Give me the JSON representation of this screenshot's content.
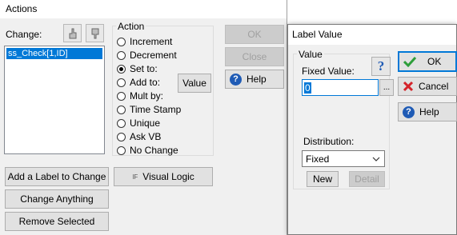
{
  "actions_window": {
    "title": "Actions",
    "change_label": "Change:",
    "change_list": [
      "ss_Check[1,ID]"
    ],
    "action_group_label": "Action",
    "radios": [
      {
        "label": "Increment",
        "checked": false
      },
      {
        "label": "Decrement",
        "checked": false
      },
      {
        "label": "Set to:",
        "checked": true
      },
      {
        "label": "Add to:",
        "checked": false
      },
      {
        "label": "Mult by:",
        "checked": false
      },
      {
        "label": "Time Stamp",
        "checked": false
      },
      {
        "label": "Unique",
        "checked": false
      },
      {
        "label": "Ask VB",
        "checked": false
      },
      {
        "label": "No Change",
        "checked": false
      }
    ],
    "value_button": "Value",
    "ok_button": "OK",
    "close_button": "Close",
    "help_button": "Help",
    "add_label_button": "Add a Label to Change",
    "visual_logic_button": "Visual Logic",
    "visual_logic_prefix": "IF",
    "change_anything_button": "Change Anything",
    "remove_selected_button": "Remove Selected"
  },
  "label_value_dialog": {
    "title": "Label Value",
    "value_group_label": "Value",
    "fixed_value_label": "Fixed Value:",
    "fixed_value": "0",
    "browse_button": "...",
    "distribution_label": "Distribution:",
    "distribution_selected": "Fixed",
    "new_button": "New",
    "detail_button": "Detail",
    "ok_button": "OK",
    "cancel_button": "Cancel",
    "help_button": "Help"
  },
  "colors": {
    "accent": "#0078d7",
    "ok_check": "#2e9e3a",
    "cancel_x": "#d4232a",
    "help_circle": "#1f5bb5"
  }
}
